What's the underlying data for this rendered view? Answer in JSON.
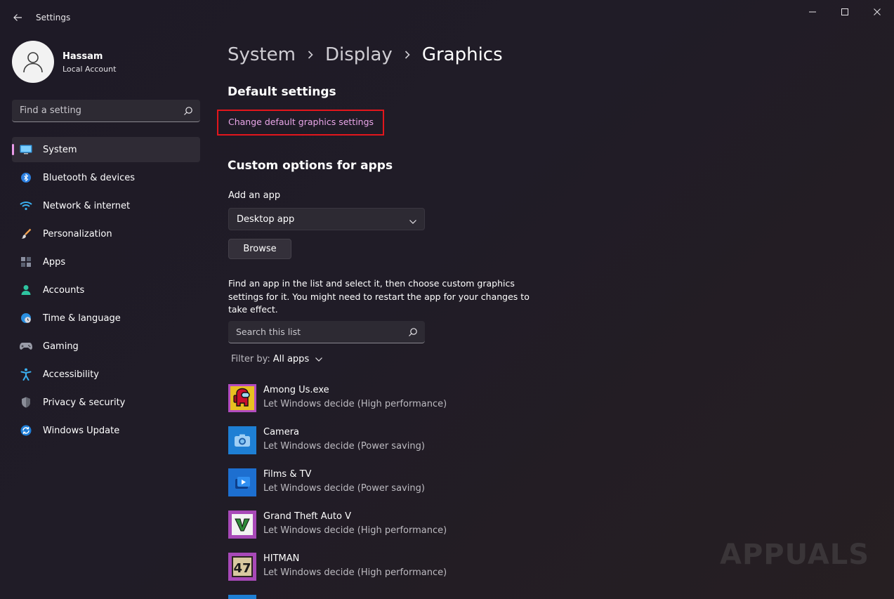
{
  "window": {
    "title": "Settings"
  },
  "profile": {
    "name": "Hassam",
    "account_type": "Local Account"
  },
  "search": {
    "placeholder": "Find a setting"
  },
  "sidebar": {
    "items": [
      {
        "label": "System",
        "icon": "system-icon",
        "active": true
      },
      {
        "label": "Bluetooth & devices",
        "icon": "bluetooth-icon"
      },
      {
        "label": "Network & internet",
        "icon": "wifi-icon"
      },
      {
        "label": "Personalization",
        "icon": "brush-icon"
      },
      {
        "label": "Apps",
        "icon": "apps-icon"
      },
      {
        "label": "Accounts",
        "icon": "accounts-icon"
      },
      {
        "label": "Time & language",
        "icon": "globe-clock-icon"
      },
      {
        "label": "Gaming",
        "icon": "gamepad-icon"
      },
      {
        "label": "Accessibility",
        "icon": "accessibility-icon"
      },
      {
        "label": "Privacy & security",
        "icon": "shield-icon"
      },
      {
        "label": "Windows Update",
        "icon": "update-icon"
      }
    ]
  },
  "breadcrumb": {
    "items": [
      "System",
      "Display",
      "Graphics"
    ]
  },
  "main": {
    "default_heading": "Default settings",
    "change_link": "Change default graphics settings",
    "custom_heading": "Custom options for apps",
    "add_app_label": "Add an app",
    "app_type_selected": "Desktop app",
    "browse_label": "Browse",
    "description": "Find an app in the list and select it, then choose custom graphics settings for it. You might need to restart the app for your changes to take effect.",
    "list_search_placeholder": "Search this list",
    "filter_label": "Filter by:",
    "filter_value": "All apps"
  },
  "apps": [
    {
      "name": "Among Us.exe",
      "preference": "Let Windows decide (High performance)",
      "icon": "among-us-icon",
      "color": "#b34cc0"
    },
    {
      "name": "Camera",
      "preference": "Let Windows decide (Power saving)",
      "icon": "camera-icon",
      "color": "#1e7fd4"
    },
    {
      "name": "Films & TV",
      "preference": "Let Windows decide (Power saving)",
      "icon": "films-tv-icon",
      "color": "#1d6fd0"
    },
    {
      "name": "Grand Theft Auto V",
      "preference": "Let Windows decide (High performance)",
      "icon": "gta-v-icon",
      "color": "#a849b8"
    },
    {
      "name": "HITMAN",
      "preference": "Let Windows decide (High performance)",
      "icon": "hitman-icon",
      "color": "#a849b8"
    }
  ],
  "watermark": {
    "text": "APPUALS"
  },
  "colors": {
    "accent": "#e99be8",
    "highlight_box": "#e3161c"
  }
}
